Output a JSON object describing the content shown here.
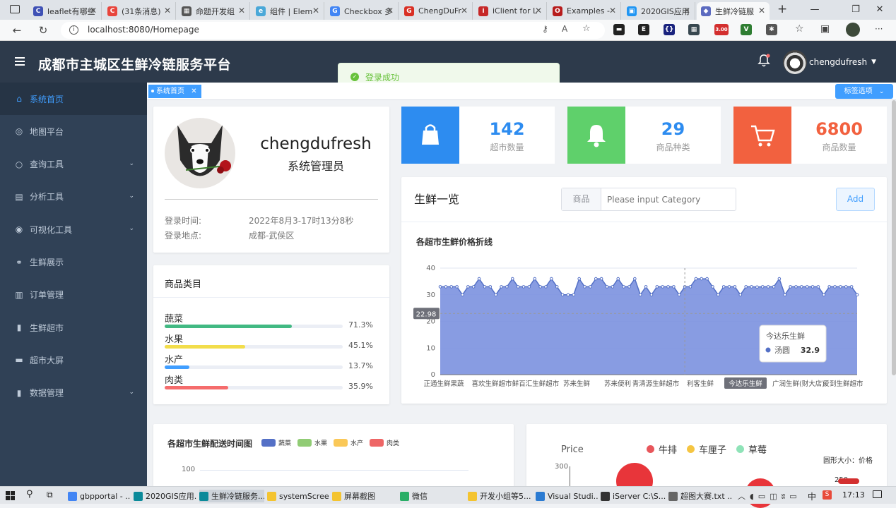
{
  "browser": {
    "tabs": [
      {
        "label": "leaflet有哪些",
        "color": "#3f51b5",
        "glyph": "C"
      },
      {
        "label": "(31条消息)",
        "color": "#e8453c",
        "glyph": "C"
      },
      {
        "label": "命题开发组",
        "color": "#555555",
        "glyph": "▦"
      },
      {
        "label": "组件 | Elem",
        "color": "#4aa8d8",
        "glyph": "e"
      },
      {
        "label": "Checkbox 多",
        "color": "#4285f4",
        "glyph": "G"
      },
      {
        "label": "ChengDuFr",
        "color": "#d93025",
        "glyph": "G"
      },
      {
        "label": "iClient for L",
        "color": "#c62828",
        "glyph": "i"
      },
      {
        "label": "Examples -",
        "color": "#b71c1c",
        "glyph": "O"
      },
      {
        "label": "2020GIS应用",
        "color": "#2196f3",
        "glyph": "▣"
      },
      {
        "label": "生鲜冷链服",
        "color": "#5c6bc0",
        "glyph": "◆"
      }
    ],
    "url": "localhost:8080/Homepage",
    "extensions": [
      {
        "color": "#222222",
        "glyph": "▬"
      },
      {
        "color": "#222222",
        "glyph": "E"
      },
      {
        "color": "#1a237e",
        "glyph": "{}"
      },
      {
        "color": "#37474f",
        "glyph": "▦"
      },
      {
        "color": "#d32f2f",
        "glyph": "3.00"
      },
      {
        "color": "#2e7d32",
        "glyph": "V"
      },
      {
        "color": "#555555",
        "glyph": "✱"
      }
    ]
  },
  "header": {
    "title": "成都市主城区生鲜冷链服务平台",
    "username": "chengdufresh"
  },
  "toast": {
    "text": "登录成功"
  },
  "sidebar": {
    "items": [
      {
        "label": "系统首页",
        "icon": "home-icon",
        "glyph": "⌂",
        "arrow": false
      },
      {
        "label": "地图平台",
        "icon": "globe-icon",
        "glyph": "◎",
        "arrow": false
      },
      {
        "label": "查询工具",
        "icon": "search-icon",
        "glyph": "○",
        "arrow": true
      },
      {
        "label": "分析工具",
        "icon": "calendar-icon",
        "glyph": "▤",
        "arrow": true
      },
      {
        "label": "可视化工具",
        "icon": "eye-icon",
        "glyph": "◉",
        "arrow": true
      },
      {
        "label": "生鲜展示",
        "icon": "share-icon",
        "glyph": "⚭",
        "arrow": false
      },
      {
        "label": "订单管理",
        "icon": "clipboard-icon",
        "glyph": "▥",
        "arrow": false
      },
      {
        "label": "生鲜超市",
        "icon": "columns-icon",
        "glyph": "▮",
        "arrow": false
      },
      {
        "label": "超市大屏",
        "icon": "server-icon",
        "glyph": "▬",
        "arrow": false
      },
      {
        "label": "数据管理",
        "icon": "chart-icon",
        "glyph": "▮",
        "arrow": true
      }
    ]
  },
  "tags": {
    "home": "系统首页",
    "options": "标签选项"
  },
  "profile": {
    "name": "chengdufresh",
    "role": "系统管理员",
    "login_time_label": "登录时间:",
    "login_time": "2022年8月3-17时13分8秒",
    "login_place_label": "登录地点:",
    "login_place": "成都-武侯区"
  },
  "stats": [
    {
      "value": "142",
      "label": "超市数量",
      "color": "#36a3f7",
      "icon": "shopping-bag-icon"
    },
    {
      "value": "29",
      "label": "商品种类",
      "color": "#40c9c6",
      "icon": "bell-icon"
    },
    {
      "value": "6800",
      "label": "商品数量",
      "color": "#f4516c",
      "icon": "cart-icon"
    }
  ],
  "categories": {
    "title": "商品类目",
    "items": [
      {
        "label": "蔬菜",
        "percent": 71.3,
        "text": "71.3%",
        "color": "#42b983"
      },
      {
        "label": "水果",
        "percent": 45.1,
        "text": "45.1%",
        "color": "#f2dd4b"
      },
      {
        "label": "水产",
        "percent": 13.7,
        "text": "13.7%",
        "color": "#409eff"
      },
      {
        "label": "肉类",
        "percent": 35.9,
        "text": "35.9%",
        "color": "#f56c6c"
      }
    ]
  },
  "fresh": {
    "title": "生鲜一览",
    "input_prepend": "商品",
    "input_placeholder": "Please input Category",
    "add_label": "Add"
  },
  "chart_data": [
    {
      "type": "area",
      "title": "各超市生鲜价格折线",
      "ylim": [
        0,
        40
      ],
      "yticks": [
        0,
        10,
        20,
        30,
        40
      ],
      "grid": true,
      "xticklabels": [
        "正通生鲜果蔬",
        "喜欢生鲜超市",
        "鲜百汇生鲜超市",
        "苏来生鲜",
        "苏来便利",
        "青清源生鲜超市",
        "利客生鲜",
        "今达乐生鲜",
        "广润生鲜(财大店)",
        "爱到生鲜超市"
      ],
      "series": [
        {
          "values": [
            33,
            33,
            33,
            33,
            30,
            33,
            33,
            36,
            33,
            33,
            30,
            33,
            33,
            36,
            33,
            33,
            33,
            36,
            33,
            33,
            36,
            33,
            30,
            30,
            30,
            36,
            33,
            33,
            36,
            36,
            33,
            33,
            36,
            33,
            33,
            36,
            30,
            33,
            30,
            33,
            33,
            33,
            33,
            30,
            33,
            33,
            36,
            36,
            36,
            33,
            30,
            33,
            33,
            33,
            30,
            33,
            33,
            32.9,
            33,
            33,
            33,
            36,
            30,
            33,
            33,
            33,
            33,
            33,
            33,
            30,
            33,
            33,
            33,
            33,
            33,
            30
          ]
        }
      ],
      "axis_pointer_value": "22.98",
      "tooltip": {
        "title": "今达乐生鲜",
        "series": "汤圆",
        "value": "32.9"
      },
      "highlight_label": "今达乐生鲜"
    },
    {
      "type": "bar",
      "title": "各超市生鲜配送时间图",
      "series": [
        {
          "name": "蔬菜"
        },
        {
          "name": "水果"
        },
        {
          "name": "水产"
        },
        {
          "name": "肉类"
        }
      ],
      "colors": [
        "#5470c6",
        "#91cc75",
        "#fac858",
        "#ee6666"
      ],
      "yticks": [
        100
      ]
    },
    {
      "type": "scatter",
      "ylabel": "Price",
      "legend": [
        {
          "name": "牛排",
          "color": "#e8565b"
        },
        {
          "name": "车厘子",
          "color": "#f5c542"
        },
        {
          "name": "草莓",
          "color": "#8fe3b8"
        }
      ],
      "note": "圆形大小：价格",
      "yticks": [
        300
      ],
      "side_value": "250"
    }
  ],
  "taskbar": {
    "items": [
      {
        "label": "gbpportal - ...",
        "color": "#4285f4"
      },
      {
        "label": "2020GIS应用...",
        "color": "#0b8a9a"
      },
      {
        "label": "生鲜冷链服务...",
        "color": "#0b8a9a",
        "on": true
      },
      {
        "label": "systemScreen",
        "color": "#f4c430"
      },
      {
        "label": "屏幕截图",
        "color": "#f4c430"
      },
      {
        "label": "微信",
        "color": "#2aae67"
      },
      {
        "label": "开发小组等5...",
        "color": "#f4c430"
      },
      {
        "label": "Visual Studi...",
        "color": "#2b7bd2"
      },
      {
        "label": "iServer C:\\S...",
        "color": "#333333"
      },
      {
        "label": "超图大赛.txt ...",
        "color": "#666666"
      }
    ],
    "ime": "中",
    "time": "17:13"
  }
}
